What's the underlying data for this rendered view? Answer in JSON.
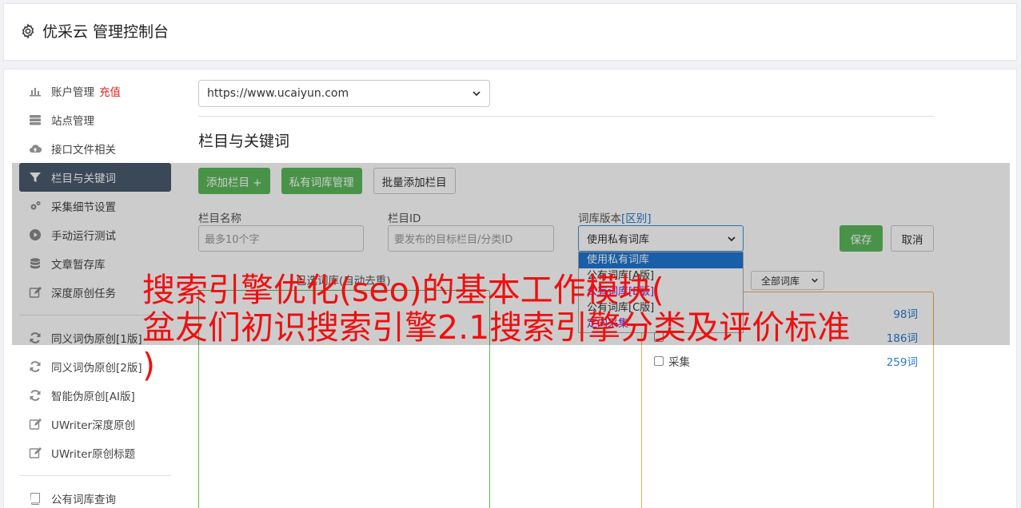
{
  "header": {
    "title": "优采云 管理控制台"
  },
  "sidebar": {
    "items": [
      {
        "label": "账户管理",
        "badge": "充值"
      },
      {
        "label": "站点管理"
      },
      {
        "label": "接口文件相关"
      },
      {
        "label": "栏目与关键词"
      },
      {
        "label": "采集细节设置"
      },
      {
        "label": "手动运行测试"
      },
      {
        "label": "文章暂存库"
      },
      {
        "label": "深度原创任务"
      },
      {
        "label": "同义词伪原创[1版]"
      },
      {
        "label": "同义词伪原创[2版]"
      },
      {
        "label": "智能伪原创[AI版]"
      },
      {
        "label": "UWriter深度原创"
      },
      {
        "label": "UWriter原创标题"
      },
      {
        "label": "公有词库查询"
      }
    ]
  },
  "main": {
    "site_select_value": "https://www.ucaiyun.com",
    "section_title": "栏目与关键词",
    "buttons": {
      "add_column": "添加栏目 +",
      "private_lib": "私有词库管理",
      "batch_add": "批量添加栏目"
    },
    "form": {
      "name_label": "栏目名称",
      "name_placeholder": "最多10个字",
      "id_label": "栏目ID",
      "id_placeholder": "要发布的目标栏目/分类ID",
      "version_label": "词库版本",
      "version_link": "[区别]",
      "version_value": "使用私有词库",
      "save": "保存",
      "cancel": "取消"
    },
    "dropdown_options": [
      "使用私有词库",
      "公有词库[A版]",
      "公有词库[B版]",
      "公有词库[C版]",
      "定向采集"
    ],
    "chosen_label": "已选词库(自动去重)",
    "filter_value": "全部词库",
    "libraries": [
      {
        "name": "",
        "count": "98词"
      },
      {
        "name": "",
        "count": "186词"
      },
      {
        "name": "采集",
        "count": "259词"
      }
    ]
  },
  "watermark": {
    "line1": "搜索引擎优化(seo)的基本工作模块(",
    "line2": "盆友们初识搜索引擎2.1搜索引擎分类及评价标准",
    "line3": ")"
  }
}
